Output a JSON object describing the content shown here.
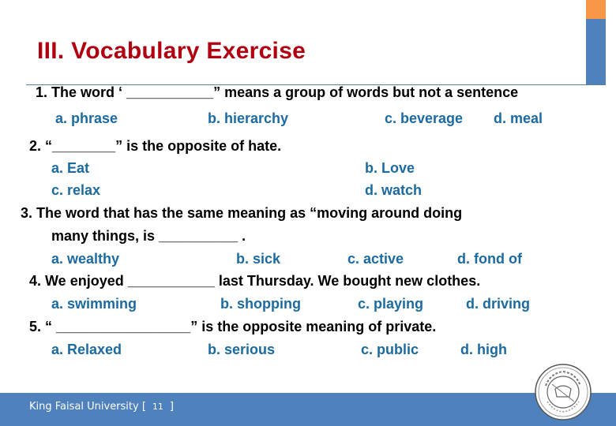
{
  "title": "III. Vocabulary Exercise",
  "colors": {
    "title": "#b10010",
    "question": "#000000",
    "option": "#1b6aa0",
    "accent_orange": "#f79646",
    "accent_blue": "#4f81bd"
  },
  "questions": [
    {
      "lines": [
        "1. The word ‘ ___________” means a group of words but not a sentence"
      ],
      "options": [
        "a. phrase",
        "b. hierarchy",
        "c. beverage",
        "d. meal"
      ]
    },
    {
      "lines": [
        "2. “________” is the opposite of hate."
      ],
      "options": [
        "a. Eat",
        "b. Love",
        "c. relax",
        "d. watch"
      ]
    },
    {
      "lines": [
        "3. The word that has the same meaning as “moving around doing",
        "many things, is __________ ."
      ],
      "options": [
        "a. wealthy",
        "b. sick",
        "c. active",
        "d. fond of"
      ]
    },
    {
      "lines": [
        "4.  We enjoyed  ___________ last Thursday. We bought new clothes."
      ],
      "options": [
        "a. swimming",
        "b. shopping",
        "c. playing",
        "d. driving"
      ]
    },
    {
      "lines": [
        "5. “ _________________” is the opposite meaning of private."
      ],
      "options": [
        "a. Relaxed",
        "b. serious",
        "c. public",
        "d. high"
      ]
    }
  ],
  "footer": {
    "university": "King Faisal University",
    "bracket_open": "[",
    "page_number": "11",
    "bracket_close": "]"
  },
  "logo": {
    "icon": "university-seal-icon"
  }
}
